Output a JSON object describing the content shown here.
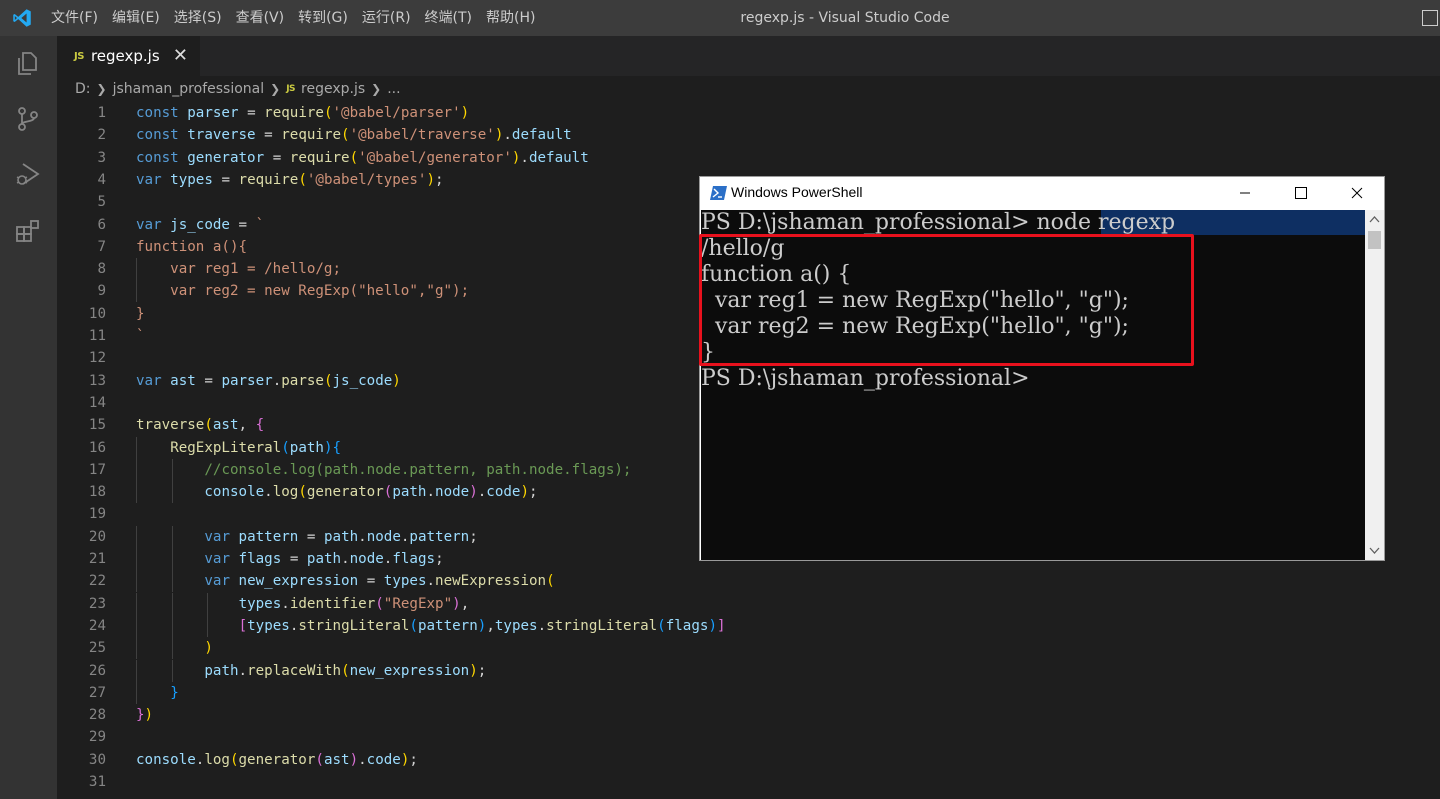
{
  "window": {
    "title": "regexp.js - Visual Studio Code"
  },
  "menu": [
    "文件(F)",
    "编辑(E)",
    "选择(S)",
    "查看(V)",
    "转到(G)",
    "运行(R)",
    "终端(T)",
    "帮助(H)"
  ],
  "activity_bar": {
    "icons": [
      "explorer-icon",
      "source-control-icon",
      "run-debug-icon",
      "extensions-icon"
    ]
  },
  "tab": {
    "badge": "JS",
    "label": "regexp.js",
    "close": "✕"
  },
  "breadcrumb": {
    "drive": "D:",
    "folder": "jshaman_professional",
    "badge": "JS",
    "file": "regexp.js",
    "more": "..."
  },
  "editor": {
    "lines": [
      "const parser = require('@babel/parser')",
      "const traverse = require('@babel/traverse').default",
      "const generator = require('@babel/generator').default",
      "var types = require('@babel/types');",
      "",
      "var js_code = `",
      "function a(){",
      "    var reg1 = /hello/g;",
      "    var reg2 = new RegExp(\"hello\",\"g\");",
      "}",
      "`",
      "",
      "var ast = parser.parse(js_code)",
      "",
      "traverse(ast, {",
      "    RegExpLiteral(path){",
      "        //console.log(path.node.pattern, path.node.flags);",
      "        console.log(generator(path.node).code);",
      "",
      "        var pattern = path.node.pattern;",
      "        var flags = path.node.flags;",
      "        var new_expression = types.newExpression(",
      "            types.identifier(\"RegExp\"),",
      "            [types.stringLiteral(pattern),types.stringLiteral(flags)]",
      "        )",
      "        path.replaceWith(new_expression);",
      "    }",
      "})",
      "",
      "console.log(generator(ast).code);",
      ""
    ]
  },
  "powershell": {
    "title": "Windows PowerShell",
    "controls": {
      "minimize": "—",
      "maximize": "☐",
      "close": "✕"
    },
    "prompt_cmd_prefix": "PS D:\\jshaman_professional> ",
    "prompt_cmd_command": "node regexp",
    "output": [
      "/hello/g",
      "function a() {",
      "  var reg1 = new RegExp(\"hello\", \"g\");",
      "  var reg2 = new RegExp(\"hello\", \"g\");",
      "}"
    ],
    "final_prompt": "PS D:\\jshaman_professional>"
  },
  "colors": {
    "keyword": "#569cd6",
    "variable": "#9cdcfe",
    "function": "#dcdcaa",
    "string": "#ce9178",
    "comment": "#6a9955",
    "highlight_box": "#e8111d"
  }
}
